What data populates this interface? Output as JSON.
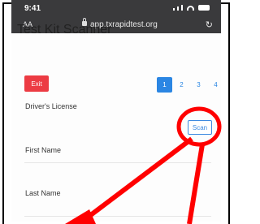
{
  "status": {
    "time": "9:41"
  },
  "browser": {
    "text_size": "AA",
    "url": "app.txrapidtest.org",
    "reload": "↻"
  },
  "page": {
    "title": "Test Kit Scanner",
    "exit_label": "Exit",
    "pages": [
      "1",
      "2",
      "3",
      "4"
    ],
    "active_page": "1"
  },
  "form": {
    "drivers_license_label": "Driver's License",
    "scan_label": "Scan",
    "first_name_label": "First Name",
    "last_name_label": "Last Name"
  },
  "annotation": {
    "color": "#ff0000"
  }
}
